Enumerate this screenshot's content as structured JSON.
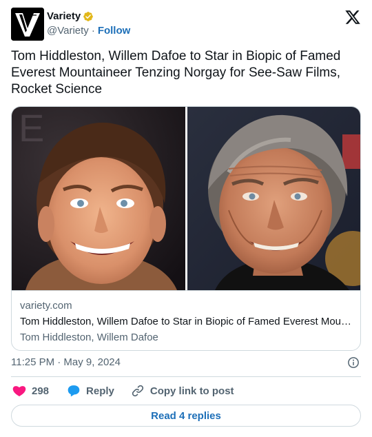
{
  "author": {
    "display_name": "Variety",
    "handle": "@Variety",
    "separator": "·",
    "follow_label": "Follow",
    "avatar_icon": "variety-v-logo",
    "verified_icon": "gold-verified-badge-icon",
    "verified_color": "#e2b719"
  },
  "platform_icon": "x-logo-icon",
  "tweet": {
    "text": "Tom Hiddleston, Willem Dafoe to Star in Biopic of Famed Everest Mountaineer Tenzing Norgay for See-Saw Films, Rocket Science"
  },
  "link_card": {
    "domain": "variety.com",
    "title": "Tom Hiddleston, Willem Dafoe to Star in Biopic of Famed Everest Mountaineer Tenzing Norgay for See-Saw Films, Rocket Science",
    "description": "Tom Hiddleston, Willem Dafoe"
  },
  "meta": {
    "timestamp": "11:25 PM · May 9, 2024",
    "info_icon": "info-circle-icon"
  },
  "actions": {
    "like_count": "298",
    "like_icon": "heart-icon",
    "like_color": "#f91880",
    "reply_label": "Reply",
    "reply_icon": "speech-bubble-icon",
    "reply_color": "#1d9bf0",
    "copy_label": "Copy link to post",
    "copy_icon": "link-icon"
  },
  "read_replies_label": "Read 4 replies",
  "colors": {
    "text_primary": "#0f1419",
    "text_secondary": "#536471",
    "link_blue": "#1d6fb8",
    "border": "#cfd9de"
  }
}
